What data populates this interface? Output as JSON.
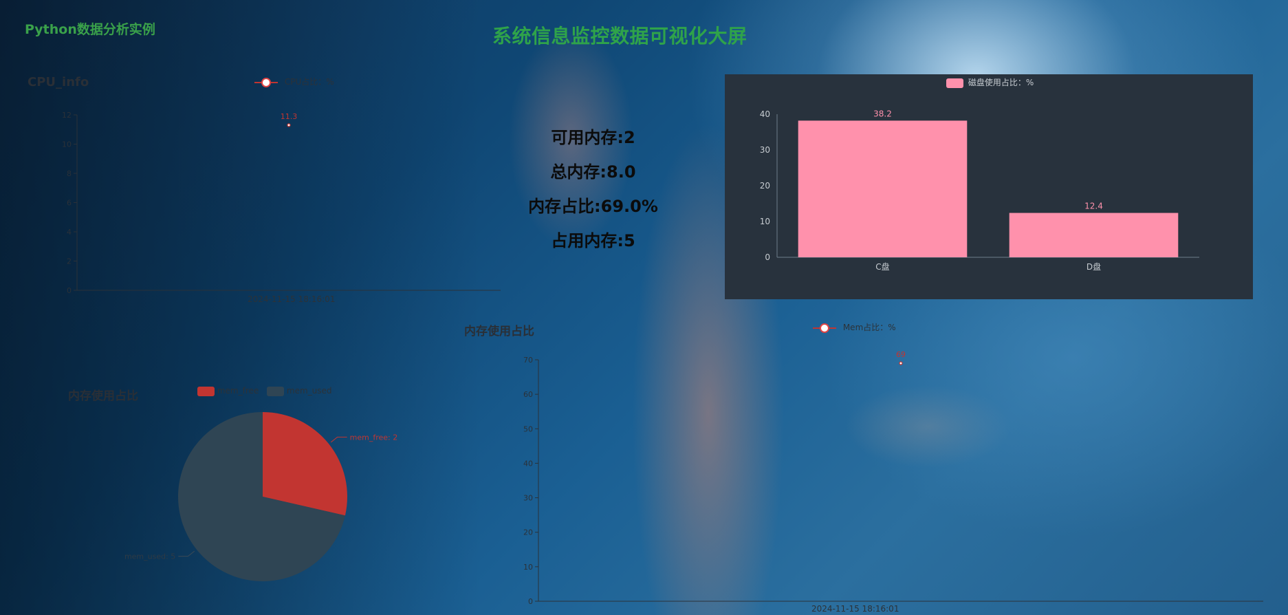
{
  "header": {
    "brand": "Python数据分析实例",
    "title": "系统信息监控数据可视化大屏"
  },
  "cpu_panel": {
    "title": "CPU_info",
    "legend": "CPU占比：%",
    "x_label": "2024-11-15 18:16:01",
    "point_label": "11.3"
  },
  "memory_stats": {
    "available": "可用内存:2",
    "total": "总内存:8.0",
    "percent": "内存占比:69.0%",
    "used": "占用内存:5"
  },
  "disk_panel": {
    "legend": "磁盘使用占比：%"
  },
  "mem_line_panel": {
    "title": "内存使用占比",
    "legend": "Mem占比：%",
    "x_label": "2024-11-15 18:16:01",
    "point_label": "69"
  },
  "mem_pie_panel": {
    "title": "内存使用占比",
    "legend": [
      "mem_free",
      "mem_used"
    ],
    "label_free": "mem_free: 2",
    "label_used": "mem_used: 5"
  },
  "colors": {
    "accent_green": "#2fa34a",
    "pie_free": "#c23531",
    "pie_used": "#2f4554",
    "bar": "#ff91ac",
    "panel_bg": "#28323d"
  },
  "chart_data": [
    {
      "id": "cpu",
      "type": "line",
      "x": [
        "2024-11-15 18:16:01"
      ],
      "series": [
        {
          "name": "CPU占比：%",
          "values": [
            11.3
          ]
        }
      ],
      "ylim": [
        0,
        12
      ],
      "yticks": [
        "0",
        "2",
        "4",
        "6",
        "8",
        "10",
        "12"
      ]
    },
    {
      "id": "disk",
      "type": "bar",
      "categories": [
        "C盘",
        "D盘"
      ],
      "series": [
        {
          "name": "磁盘使用占比：%",
          "values": [
            38.2,
            12.4
          ]
        }
      ],
      "ylim": [
        0,
        40
      ],
      "yticks": [
        "0",
        "10",
        "20",
        "30",
        "40"
      ]
    },
    {
      "id": "mem_line",
      "type": "line",
      "x": [
        "2024-11-15 18:16:01"
      ],
      "series": [
        {
          "name": "Mem占比：%",
          "values": [
            69
          ]
        }
      ],
      "ylim": [
        0,
        70
      ],
      "yticks": [
        "0",
        "10",
        "20",
        "30",
        "40",
        "50",
        "60",
        "70"
      ]
    },
    {
      "id": "mem_pie",
      "type": "pie",
      "categories": [
        "mem_free",
        "mem_used"
      ],
      "values": [
        2,
        5
      ]
    }
  ]
}
